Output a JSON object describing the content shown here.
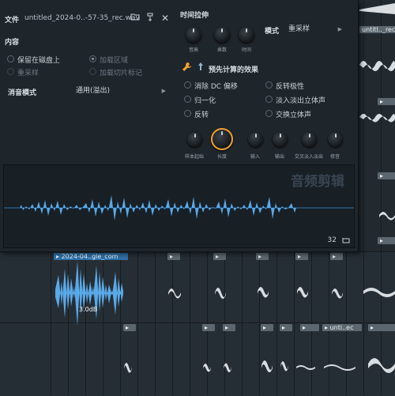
{
  "header": {
    "file_label": "文件",
    "file_name": "untitled_2024-0..-57-35_rec.wav"
  },
  "content": {
    "section_label": "内容",
    "keep_on_disk": "保留在磁盘上",
    "resample": "重采样",
    "load_region": "加载区域",
    "load_slice_markers": "加载切片标记"
  },
  "declick": {
    "label": "消音模式",
    "value": "通用(溢出)"
  },
  "time_stretch": {
    "label": "时间拉伸",
    "knobs": [
      "音高",
      "乘数",
      "时间"
    ],
    "mode_label": "模式",
    "mode_value": "重采样"
  },
  "precompute": {
    "title": "预先计算的效果",
    "options": [
      "消除 DC 偏移",
      "归一化",
      "反转",
      "反转极性",
      "淡入淡出立体声",
      "交换立体声"
    ]
  },
  "bottom_knobs": [
    "样本起始",
    "长度",
    "输入",
    "输出",
    "交叉淡入淡出",
    "修音"
  ],
  "wave_panel": {
    "title": "音频剪辑",
    "counter": "32"
  },
  "playlist": {
    "clip_labels": [
      "untitl.._rec",
      "2024-04..gle_com",
      "unti..ec"
    ],
    "gain_readout": "3.0dB"
  },
  "colors": {
    "waveform": "#5aa9e8",
    "accent_orange": "#f0a030",
    "panel_bg": "#1e252b"
  }
}
